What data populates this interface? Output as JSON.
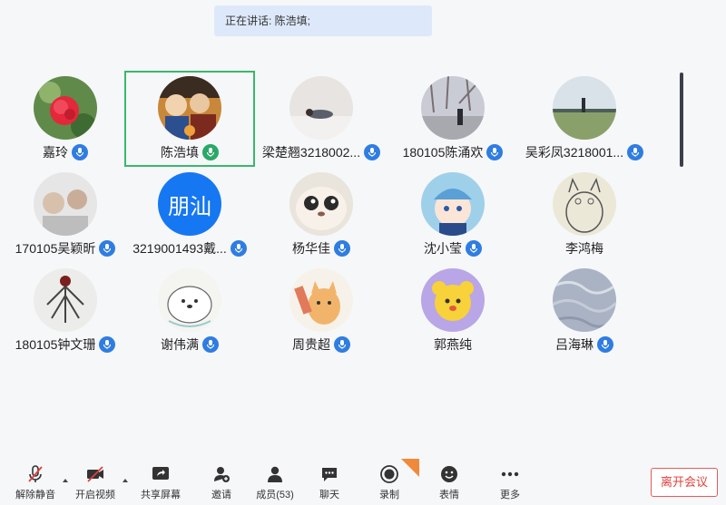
{
  "speaking": {
    "text": "正在讲话: 陈浩填;"
  },
  "participants": [
    {
      "name": "嘉玲",
      "avatar": "red-flower-photo",
      "mic": "on"
    },
    {
      "name": "陈浩填",
      "avatar": "anime-group-photo",
      "mic": "speaking",
      "active": true
    },
    {
      "name": "梁楚翘3218002...",
      "avatar": "person-lying-photo",
      "mic": "on"
    },
    {
      "name": "180105陈涌欢",
      "avatar": "winter-trees-photo",
      "mic": "on"
    },
    {
      "name": "吴彩凤3218001...",
      "avatar": "lakeside-photo",
      "mic": "on"
    },
    {
      "name": "170105吴颖昕",
      "avatar": "two-people-photo",
      "mic": "on"
    },
    {
      "name": "3219001493戴...",
      "avatar_text": "朋汕",
      "mic": "on"
    },
    {
      "name": "杨华佳",
      "avatar": "cartoon-seal-photo",
      "mic": "on"
    },
    {
      "name": "沈小莹",
      "avatar": "anime-cat-girl-photo",
      "mic": "on"
    },
    {
      "name": "李鸿梅",
      "avatar": "totoro-sketch",
      "mic": "none"
    },
    {
      "name": "180105钟文珊",
      "avatar": "tree-ink-photo",
      "mic": "on"
    },
    {
      "name": "谢伟满",
      "avatar": "white-bear-sketch",
      "mic": "on"
    },
    {
      "name": "周贵超",
      "avatar": "cat-sticker",
      "mic": "on"
    },
    {
      "name": "郭燕纯",
      "avatar": "kero-cartoon",
      "mic": "none"
    },
    {
      "name": "吕海琳",
      "avatar": "blue-texture-photo",
      "mic": "on"
    }
  ],
  "toolbar": {
    "unmute": "解除静音",
    "start_video": "开启视频",
    "share_screen": "共享屏幕",
    "invite": "邀请",
    "members": "成员(53)",
    "chat": "聊天",
    "record": "录制",
    "reactions": "表情",
    "more": "更多",
    "leave": "离开会议"
  },
  "colors": {
    "accent": "#2f7de1",
    "speaking": "#2aa866",
    "danger": "#e0403d"
  }
}
